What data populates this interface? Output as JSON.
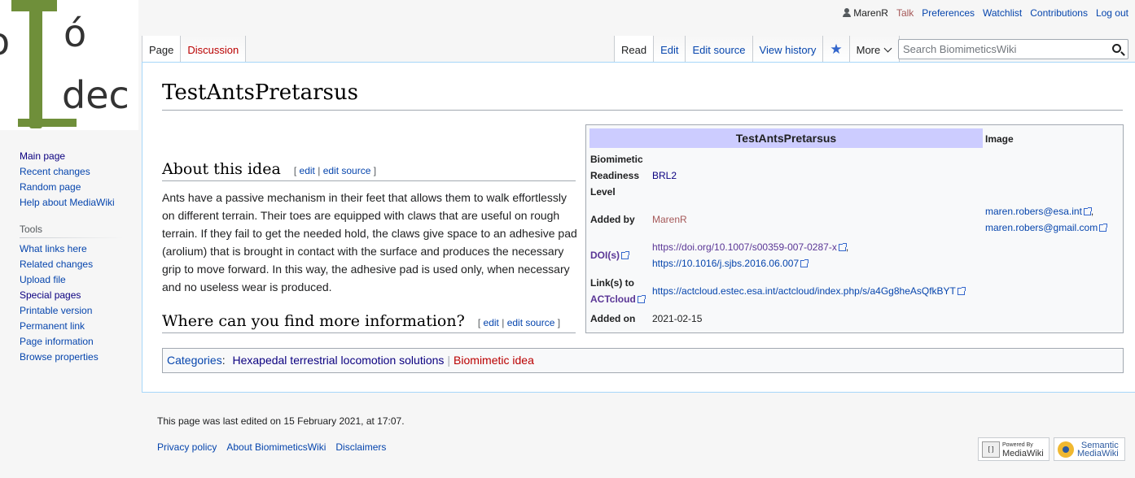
{
  "personal": {
    "username": "MarenR",
    "talk": "Talk",
    "preferences": "Preferences",
    "watchlist": "Watchlist",
    "contributions": "Contributions",
    "logout": "Log out"
  },
  "tabs_left": [
    {
      "label": "Page",
      "selected": true
    },
    {
      "label": "Discussion",
      "selected": false
    }
  ],
  "tabs_right": {
    "read": "Read",
    "edit": "Edit",
    "edit_source": "Edit source",
    "view_history": "View history",
    "more": "More"
  },
  "search": {
    "placeholder": "Search BiomimeticsWiki"
  },
  "page": {
    "title": "TestAntsPretarsus",
    "section1": {
      "heading": "About this idea",
      "edit": "edit",
      "sep": "|",
      "edit_source": "edit source"
    },
    "paragraph": "Ants have a passive mechanism in their feet that allows them to walk effortlessly on different terrain. Their toes are equipped with claws that are useful on rough terrain. If they fail to get the needed hold, the claws give space to an adhesive pad (arolium) that is brought in contact with the surface and produces the necessary grip to move forward. In this way, the adhesive pad is used only, when necessary and no useless wear is produced.",
    "section2": {
      "heading": "Where can you find more information?",
      "edit": "edit",
      "sep": "|",
      "edit_source": "edit source"
    }
  },
  "infobox": {
    "title": "TestAntsPretarsus",
    "image_header": "Image",
    "brl_label_1": "Biomimetic",
    "brl_label_2": "Readiness",
    "brl_label_3": "Level",
    "brl_value": "BRL2",
    "added_by_label": "Added by",
    "added_by_value": "MarenR",
    "email_1": "maren.robers@esa.int",
    "email_sep": ",",
    "email_2": "maren.robers@gmail.com",
    "doi_label": "DOI(s)",
    "doi_1": "https://doi.org/10.1007/s00359-007-0287-x",
    "doi_sep": ",",
    "doi_2": "https://10.1016/j.sjbs.2016.06.007",
    "link_label_1": "Link(s) to",
    "link_label_2": "ACTcloud",
    "link_value": "https://actcloud.estec.esa.int/actcloud/index.php/s/a4Gg8heAsQfkBYT",
    "added_on_label": "Added on",
    "added_on_value": "2021-02-15"
  },
  "categories": {
    "label": "Categories",
    "colon": ":",
    "items": [
      "Hexapedal terrestrial locomotion solutions",
      "Biomimetic idea"
    ]
  },
  "sidebar": {
    "nav": [
      "Main page",
      "Recent changes",
      "Random page",
      "Help about MediaWiki"
    ],
    "tools_heading": "Tools",
    "tools": [
      "What links here",
      "Related changes",
      "Upload file",
      "Special pages",
      "Printable version",
      "Permanent link",
      "Page information",
      "Browse properties"
    ]
  },
  "logo": {
    "text_top": "ó",
    "text_left": "o",
    "text_bottom": "dec"
  },
  "footer": {
    "last_edited": "This page was last edited on 15 February 2021, at 17:07.",
    "links": [
      "Privacy policy",
      "About BiomimeticsWiki",
      "Disclaimers"
    ],
    "badge_mw_1": "Powered By",
    "badge_mw_2": "MediaWiki",
    "badge_smw_1": "Semantic",
    "badge_smw_2": "MediaWiki",
    "badge_mw_logo": "[ ]"
  },
  "colors": {
    "link": "#0645ad",
    "redlink": "#ba0000",
    "infobox_title_bg": "#ccccff"
  }
}
